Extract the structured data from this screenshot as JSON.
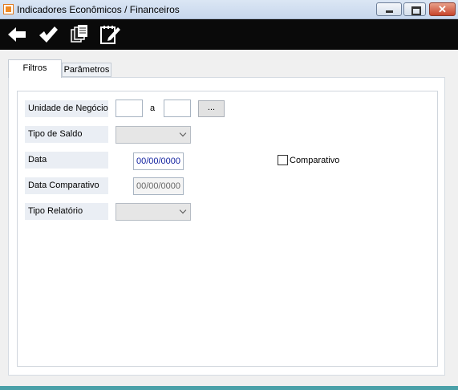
{
  "window": {
    "title": "Indicadores Econômicos / Financeiros",
    "close_glyph": "✕"
  },
  "toolbar": {
    "icons": [
      "arrow-left-icon",
      "checkmark-icon",
      "copy-pages-icon",
      "edit-notepad-icon"
    ]
  },
  "tabs": [
    {
      "label": "Filtros",
      "active": true
    },
    {
      "label": "Parâmetros",
      "active": false
    }
  ],
  "form": {
    "unidade": {
      "label": "Unidade de Negócio",
      "from": "",
      "separator": "a",
      "to": "",
      "lookup": "..."
    },
    "tipo_saldo": {
      "label": "Tipo de Saldo",
      "value": ""
    },
    "data": {
      "label": "Data",
      "value": "00/00/0000"
    },
    "comparativo_check": {
      "label": "Comparativo",
      "checked": false
    },
    "data_comparativo": {
      "label": "Data Comparativo",
      "value": "00/00/0000"
    },
    "tipo_relatorio": {
      "label": "Tipo Relatório",
      "value": ""
    }
  }
}
